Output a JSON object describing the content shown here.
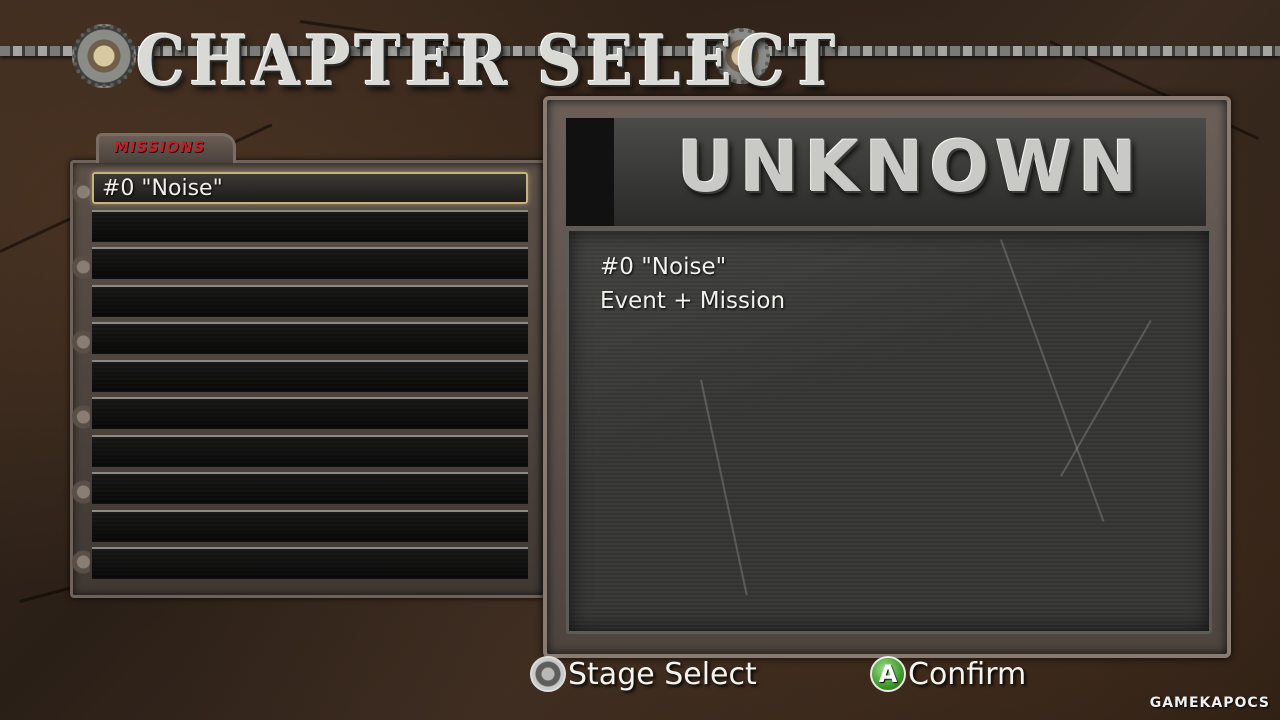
{
  "header": {
    "title": "CHAPTER SELECT",
    "gear_icon": "gear-icon"
  },
  "missions": {
    "tab_label": "MISSIONS",
    "tab_color": "#c0202a",
    "items": [
      {
        "label": "#0 \"Noise\"",
        "selected": true
      },
      {
        "label": ""
      },
      {
        "label": ""
      },
      {
        "label": ""
      },
      {
        "label": ""
      },
      {
        "label": ""
      },
      {
        "label": ""
      },
      {
        "label": ""
      },
      {
        "label": ""
      },
      {
        "label": ""
      },
      {
        "label": ""
      }
    ]
  },
  "detail": {
    "title": "UNKNOWN",
    "mission_name": "#0 \"Noise\"",
    "mission_type": "Event + Mission"
  },
  "prompts": {
    "stage_select_icon": "dpad-icon",
    "stage_select_label": "Stage Select",
    "confirm_icon_glyph": "A",
    "confirm_icon_color": "#3f9a2c",
    "confirm_label": "Confirm"
  },
  "watermark": "GAMEKAPOCS"
}
